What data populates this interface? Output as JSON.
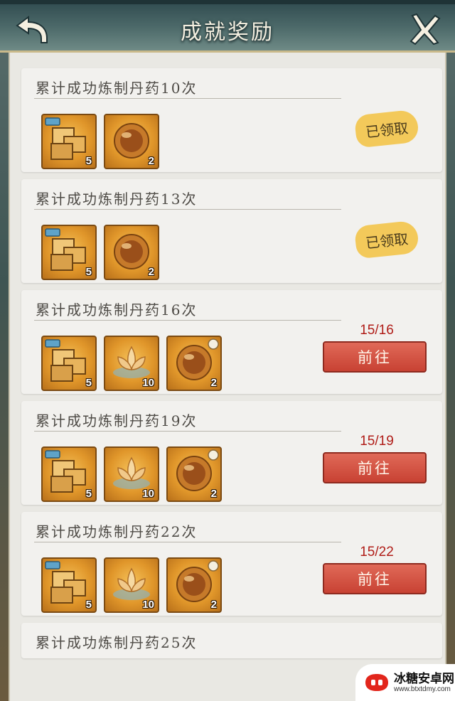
{
  "header": {
    "title": "成就奖励",
    "back_icon": "back-arrow-icon",
    "close_icon": "close-icon"
  },
  "achievements": [
    {
      "title": "累计成功炼制丹药10次",
      "status": "claimed",
      "claimed_label": "已领取",
      "rewards": [
        {
          "icon": "gold-boxes-icon",
          "qty": "5"
        },
        {
          "icon": "elixir-orb-icon",
          "qty": "2"
        }
      ]
    },
    {
      "title": "累计成功炼制丹药13次",
      "status": "claimed",
      "claimed_label": "已领取",
      "rewards": [
        {
          "icon": "gold-boxes-icon",
          "qty": "5"
        },
        {
          "icon": "elixir-orb-icon",
          "qty": "2"
        }
      ]
    },
    {
      "title": "累计成功炼制丹药16次",
      "status": "in_progress",
      "progress": "15/16",
      "button_label": "前往",
      "rewards": [
        {
          "icon": "gold-boxes-icon",
          "qty": "5"
        },
        {
          "icon": "lotus-icon",
          "qty": "10"
        },
        {
          "icon": "elixir-orb-icon",
          "qty": "2"
        }
      ]
    },
    {
      "title": "累计成功炼制丹药19次",
      "status": "in_progress",
      "progress": "15/19",
      "button_label": "前往",
      "rewards": [
        {
          "icon": "gold-boxes-icon",
          "qty": "5"
        },
        {
          "icon": "lotus-icon",
          "qty": "10"
        },
        {
          "icon": "elixir-orb-icon",
          "qty": "2"
        }
      ]
    },
    {
      "title": "累计成功炼制丹药22次",
      "status": "in_progress",
      "progress": "15/22",
      "button_label": "前往",
      "rewards": [
        {
          "icon": "gold-boxes-icon",
          "qty": "5"
        },
        {
          "icon": "lotus-icon",
          "qty": "10"
        },
        {
          "icon": "elixir-orb-icon",
          "qty": "2"
        }
      ]
    },
    {
      "title": "累计成功炼制丹药25次"
    }
  ],
  "watermark": {
    "text": "冰糖安卓网",
    "url": "www.btxtdmy.com"
  },
  "colors": {
    "panel": "#e9e8e3",
    "card": "#f2f1ee",
    "progress_text": "#b01d18",
    "go_button": "#d35443",
    "claimed_badge": "#f3c95a"
  }
}
